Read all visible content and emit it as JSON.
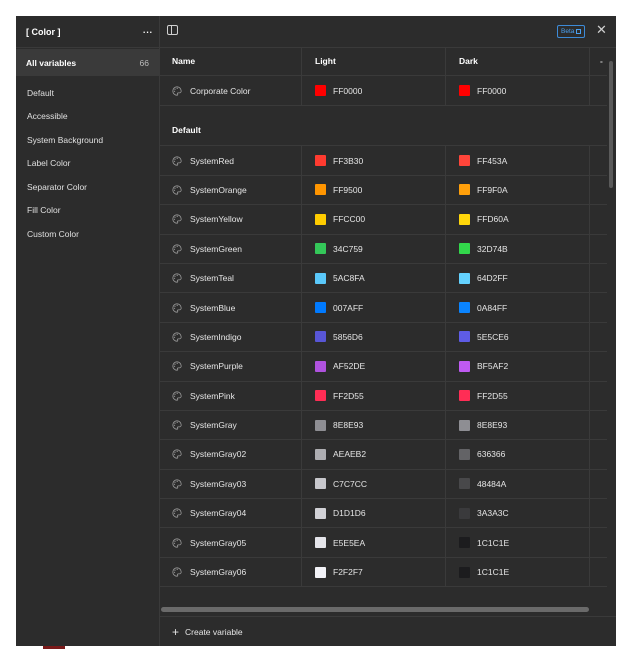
{
  "sidebar": {
    "title": "[ Color ]",
    "more_label": "···",
    "all": {
      "label": "All variables",
      "count": "66"
    },
    "items": [
      "Default",
      "Accessible",
      "System Background",
      "Label Color",
      "Separator Color",
      "Fill Color",
      "Custom Color"
    ]
  },
  "topbar": {
    "beta_label": "Beta",
    "close_label": "✕"
  },
  "table": {
    "headers": {
      "name": "Name",
      "light": "Light",
      "dark": "Dark",
      "extra": "-"
    },
    "ungrouped": [
      {
        "name": "Corporate Color",
        "light": "FF0000",
        "dark": "FF0000",
        "light_color": "#FF0000",
        "dark_color": "#FF0000"
      }
    ],
    "group_title": "Default",
    "rows": [
      {
        "name": "SystemRed",
        "light": "FF3B30",
        "dark": "FF453A",
        "light_color": "#FF3B30",
        "dark_color": "#FF453A"
      },
      {
        "name": "SystemOrange",
        "light": "FF9500",
        "dark": "FF9F0A",
        "light_color": "#FF9500",
        "dark_color": "#FF9F0A"
      },
      {
        "name": "SystemYellow",
        "light": "FFCC00",
        "dark": "FFD60A",
        "light_color": "#FFCC00",
        "dark_color": "#FFD60A"
      },
      {
        "name": "SystemGreen",
        "light": "34C759",
        "dark": "32D74B",
        "light_color": "#34C759",
        "dark_color": "#32D74B"
      },
      {
        "name": "SystemTeal",
        "light": "5AC8FA",
        "dark": "64D2FF",
        "light_color": "#5AC8FA",
        "dark_color": "#64D2FF"
      },
      {
        "name": "SystemBlue",
        "light": "007AFF",
        "dark": "0A84FF",
        "light_color": "#007AFF",
        "dark_color": "#0A84FF"
      },
      {
        "name": "SystemIndigo",
        "light": "5856D6",
        "dark": "5E5CE6",
        "light_color": "#5856D6",
        "dark_color": "#5E5CE6"
      },
      {
        "name": "SystemPurple",
        "light": "AF52DE",
        "dark": "BF5AF2",
        "light_color": "#AF52DE",
        "dark_color": "#BF5AF2"
      },
      {
        "name": "SystemPink",
        "light": "FF2D55",
        "dark": "FF2D55",
        "light_color": "#FF2D55",
        "dark_color": "#FF2D55"
      },
      {
        "name": "SystemGray",
        "light": "8E8E93",
        "dark": "8E8E93",
        "light_color": "#8E8E93",
        "dark_color": "#8E8E93"
      },
      {
        "name": "SystemGray02",
        "light": "AEAEB2",
        "dark": "636366",
        "light_color": "#AEAEB2",
        "dark_color": "#636366"
      },
      {
        "name": "SystemGray03",
        "light": "C7C7CC",
        "dark": "48484A",
        "light_color": "#C7C7CC",
        "dark_color": "#48484A"
      },
      {
        "name": "SystemGray04",
        "light": "D1D1D6",
        "dark": "3A3A3C",
        "light_color": "#D1D1D6",
        "dark_color": "#3A3A3C"
      },
      {
        "name": "SystemGray05",
        "light": "E5E5EA",
        "dark": "1C1C1E",
        "light_color": "#E5E5EA",
        "dark_color": "#1C1C1E"
      },
      {
        "name": "SystemGray06",
        "light": "F2F2F7",
        "dark": "1C1C1E",
        "light_color": "#F2F2F7",
        "dark_color": "#1C1C1E"
      }
    ]
  },
  "footer": {
    "plus": "+",
    "create_label": "Create variable"
  },
  "colors": {
    "panel_bg": "#2C2C2C",
    "border": "#3A3A3A",
    "accent": "#3D8BD8"
  }
}
